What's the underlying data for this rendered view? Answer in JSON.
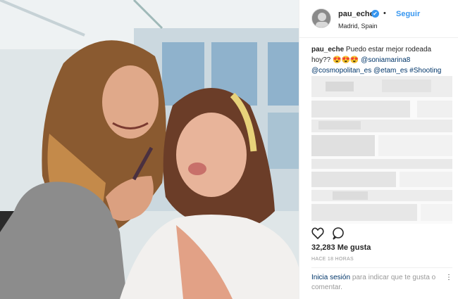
{
  "post": {
    "username": "pau_eche",
    "verified_mark": "✔",
    "dot": "•",
    "follow_label": "Seguir",
    "location": "Madrid, Spain",
    "caption_user": "pau_eche",
    "caption_text": "Puedo estar mejor rodeada hoy?? 😍😍😍",
    "mentions": [
      "@soniamarina8",
      "@cosmopolitan_es",
      "@etam_es",
      "#Shooting"
    ],
    "likes": "32,283 Me gusta",
    "time": "HACE 18 HORAS",
    "login_link": "Inicia sesión",
    "login_text": "para indicar que te gusta o comentar.",
    "more_icon": "⋮"
  },
  "icons": {
    "like": "heart-icon",
    "comment": "comment-icon"
  }
}
